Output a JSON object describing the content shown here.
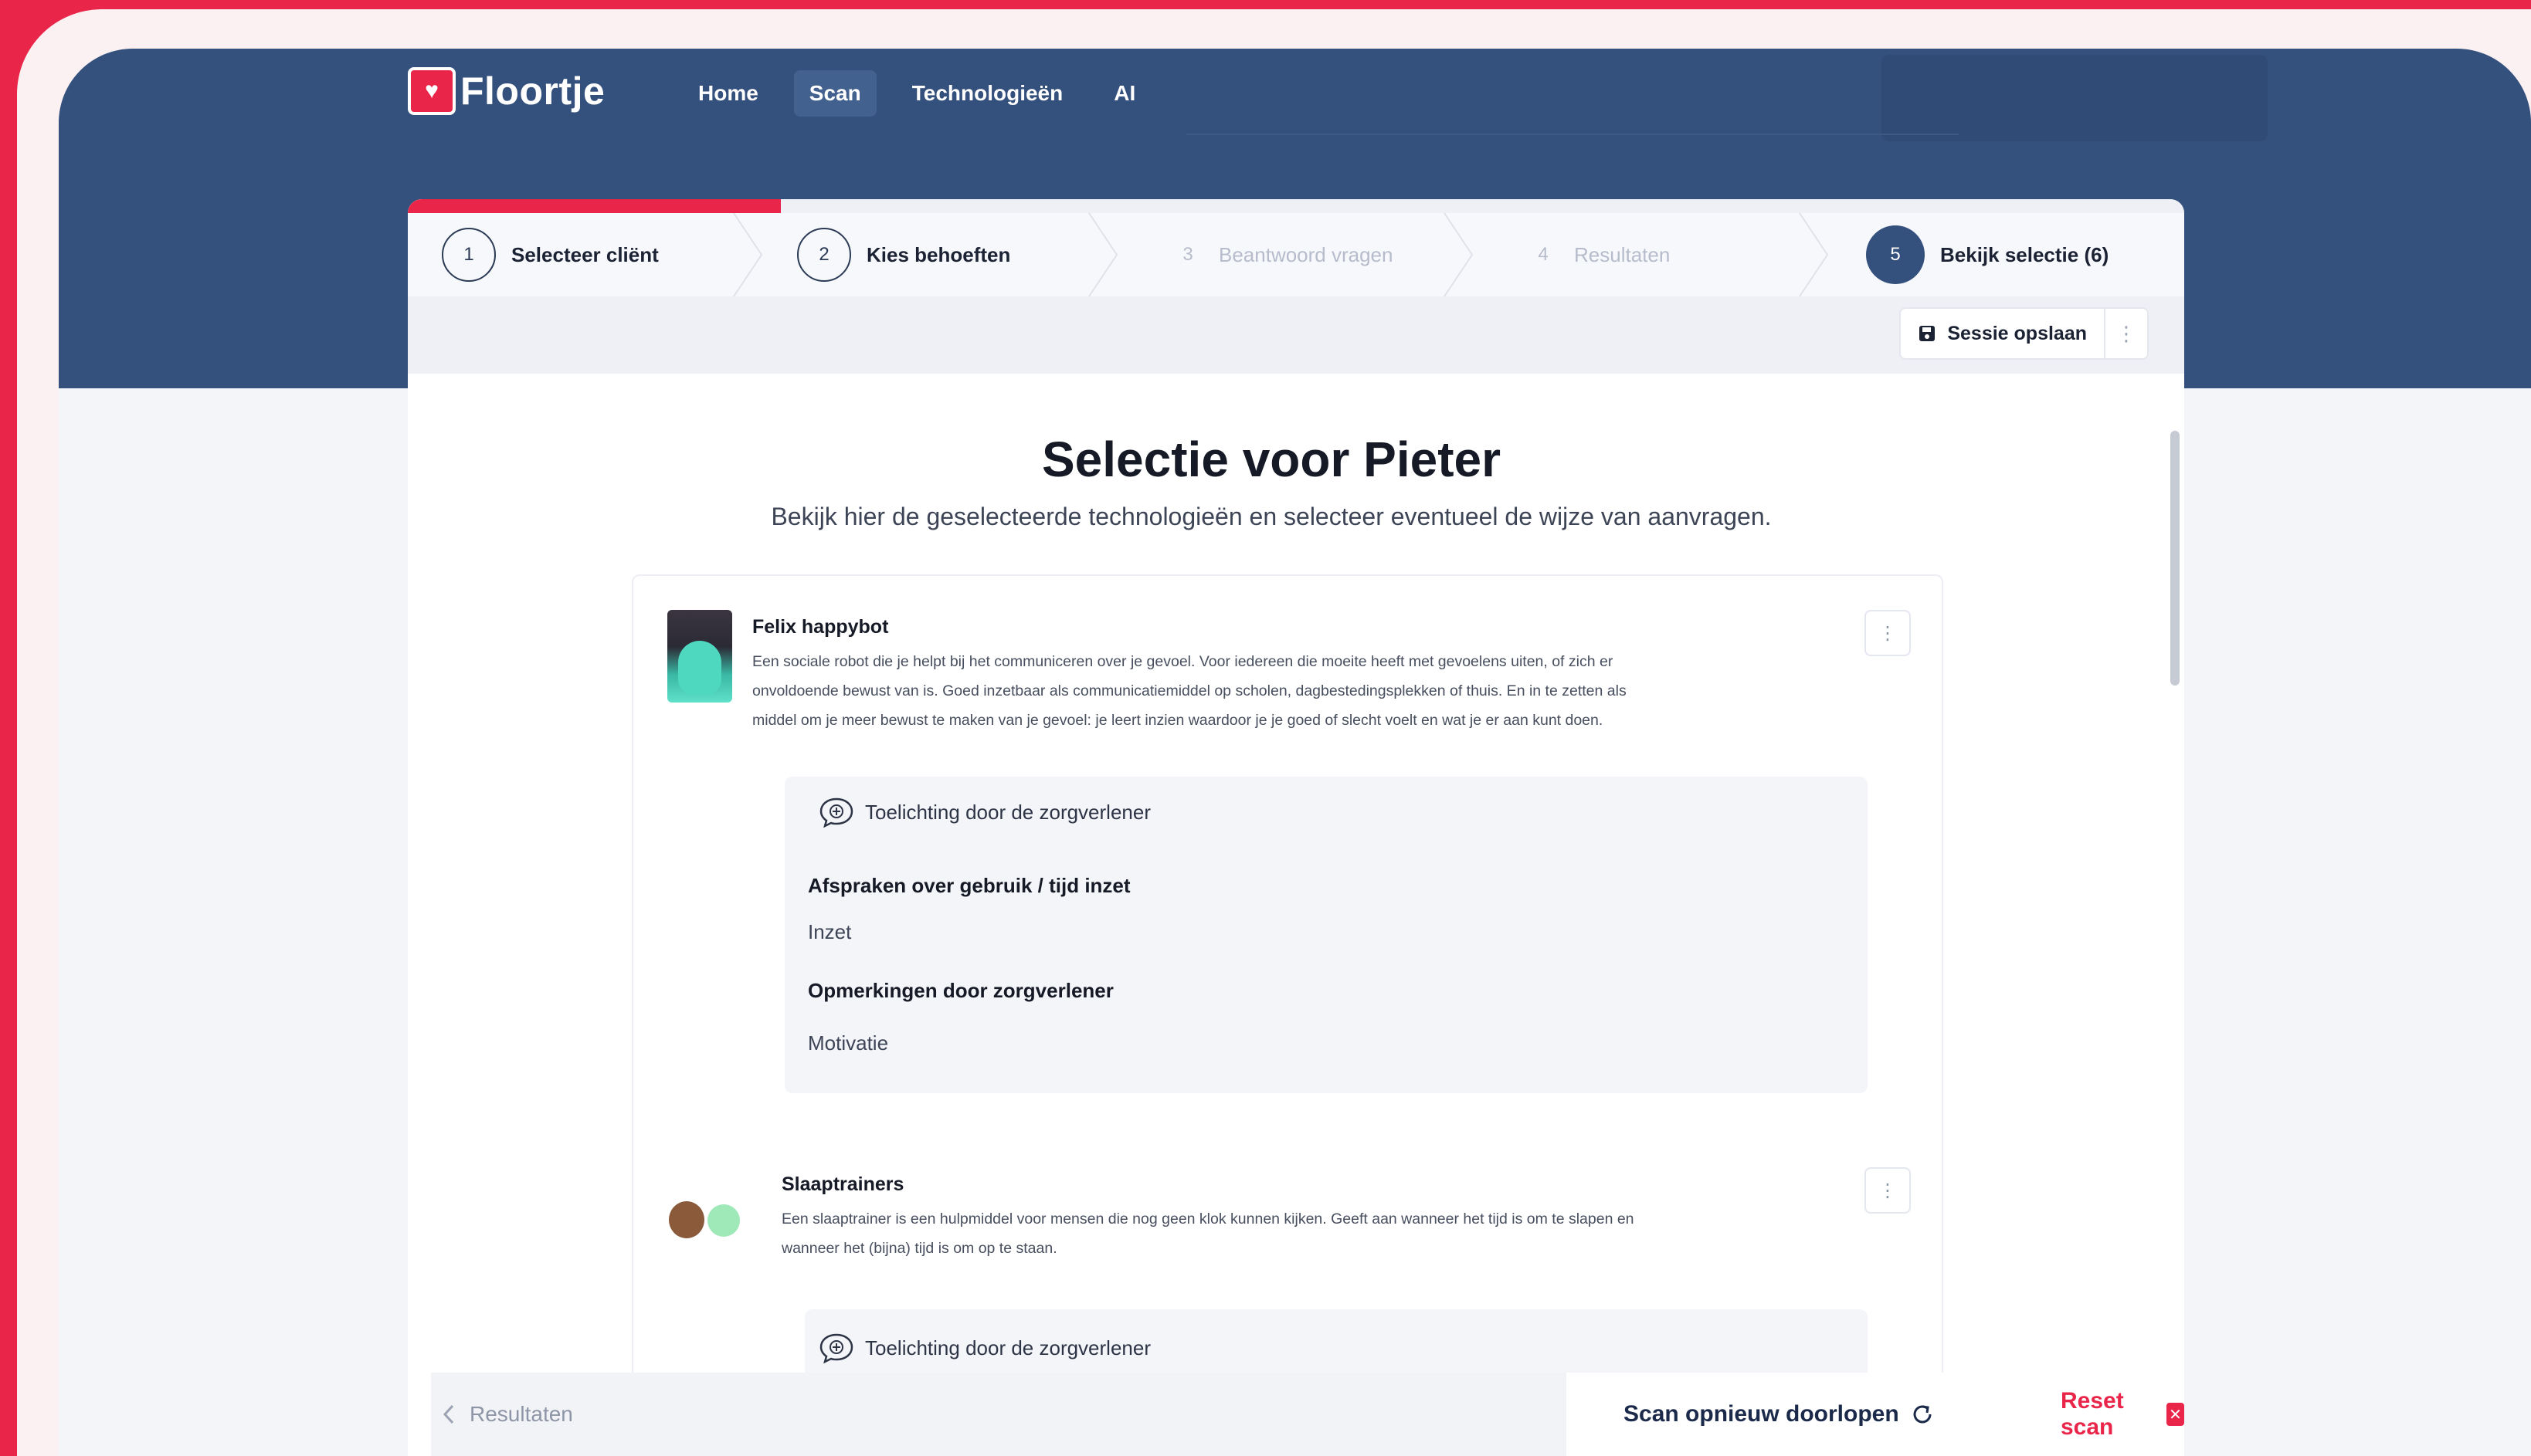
{
  "brand": {
    "name": "Floortje",
    "logo_icon": "hand-heart-icon"
  },
  "nav": {
    "items": [
      {
        "label": "Home"
      },
      {
        "label": "Scan"
      },
      {
        "label": "Technologieën"
      },
      {
        "label": "AI"
      }
    ],
    "active": "Scan"
  },
  "steps": [
    {
      "num": "1",
      "label": "Selecteer cliënt"
    },
    {
      "num": "2",
      "label": "Kies behoeften"
    },
    {
      "num": "3",
      "label": "Beantwoord vragen"
    },
    {
      "num": "4",
      "label": "Resultaten"
    },
    {
      "num": "5",
      "label": "Bekijk selectie (6)"
    }
  ],
  "progress": {
    "fraction": 0.21
  },
  "toolbar": {
    "save_label": "Sessie opslaan"
  },
  "page": {
    "title": "Selectie voor Pieter",
    "subtitle": "Bekijk hier de geselecteerde technologieën en selecteer eventueel de wijze van aanvragen."
  },
  "items": [
    {
      "title": "Felix happybot",
      "desc_lines": [
        "Een sociale robot die je helpt bij het communiceren over je gevoel. Voor iedereen die moeite heeft met gevoelens uiten, of zich er",
        "onvoldoende bewust van is. Goed inzetbaar als communicatiemiddel op scholen, dagbestedingsplekken of thuis. En in te zetten als",
        "middel om je meer bewust te maken van je gevoel: je leert inzien waardoor je je goed of slecht voelt en wat je er aan kunt doen."
      ],
      "note": {
        "heading": "Toelichting door de zorgverlener",
        "fields": [
          {
            "label": "Afspraken over gebruik / tijd inzet",
            "value": "Inzet"
          },
          {
            "label": "Opmerkingen door zorgverlener",
            "value": "Motivatie"
          }
        ]
      }
    },
    {
      "title": "Slaaptrainers",
      "desc_lines": [
        "Een slaaptrainer is een hulpmiddel voor mensen die nog geen klok kunnen kijken. Geeft aan wanneer het tijd is om te slapen en",
        "wanneer het (bijna) tijd is om op te staan."
      ],
      "note": {
        "heading": "Toelichting door de zorgverlener"
      }
    }
  ],
  "footer": {
    "back_label": "Resultaten",
    "rescan_label": "Scan opnieuw doorlopen",
    "reset_label": "Reset scan"
  },
  "colors": {
    "brand_red": "#e9264a",
    "navy": "#34507d"
  }
}
